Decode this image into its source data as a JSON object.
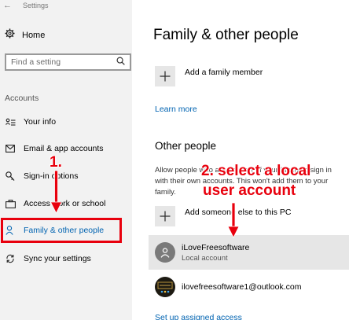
{
  "window": {
    "title": "Settings"
  },
  "sidebar": {
    "home_label": "Home",
    "search_placeholder": "Find a setting",
    "section_label": "Accounts",
    "items": [
      {
        "label": "Your info",
        "icon": "person-card-icon"
      },
      {
        "label": "Email & app accounts",
        "icon": "mail-icon"
      },
      {
        "label": "Sign-in options",
        "icon": "key-icon"
      },
      {
        "label": "Access work or school",
        "icon": "briefcase-icon"
      },
      {
        "label": "Family & other people",
        "icon": "people-icon",
        "selected": true
      },
      {
        "label": "Sync your settings",
        "icon": "sync-icon"
      }
    ]
  },
  "main": {
    "title": "Family & other people",
    "add_family_label": "Add a family member",
    "learn_more": "Learn more",
    "other_people_title": "Other people",
    "other_people_desc": "Allow people who are not part of your family to sign in with their own accounts. This won't add them to your family.",
    "add_someone_label": "Add someone else to this PC",
    "accounts": [
      {
        "name": "iLoveFreesoftware",
        "subtitle": "Local account"
      },
      {
        "name": "ilovefreesoftware1@outlook.com",
        "subtitle": ""
      }
    ],
    "set_up_assigned_access": "Set up assigned access"
  },
  "annotations": {
    "step1": "1.",
    "step2_line1": "2. select a local",
    "step2_line2": "user account",
    "color": "#e8000d"
  },
  "colors": {
    "accent": "#0063b1",
    "sidebar_bg": "#f2f2f2",
    "highlight": "#e6e6e6"
  }
}
